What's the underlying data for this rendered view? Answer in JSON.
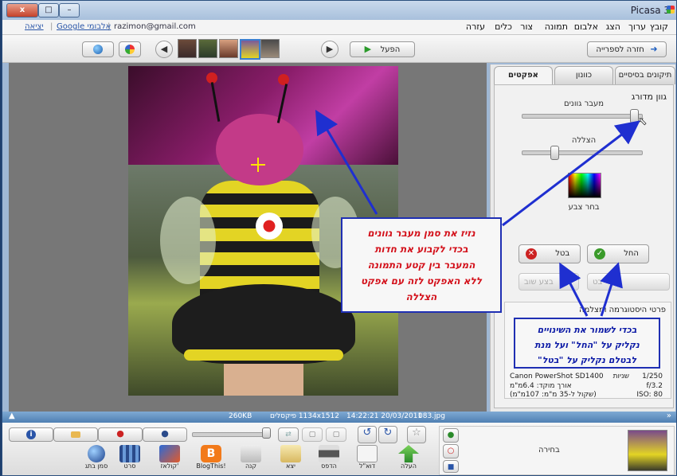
{
  "window": {
    "title": "Picasa 3",
    "close": "x",
    "max": "□",
    "min": "–"
  },
  "menu": [
    "קובץ",
    "ערוך",
    "הצג",
    "אלבום",
    "תמונה",
    "צור",
    "כלים",
    "עזרה"
  ],
  "account": {
    "email": "razimon@gmail.com",
    "google_link": "Google אלבומי",
    "exit": "יציאה"
  },
  "toolbar": {
    "back_label": "חזרה לספרייה",
    "play_label": "הפעל"
  },
  "tabs": [
    "תיקונים בסיסיים",
    "כוונון",
    "אפקטים"
  ],
  "effect": {
    "title": "גוון מדורג",
    "fade_label": "מעבר גוונים",
    "fade_level": 0.97,
    "shade_label": "הצללה",
    "shade_level": 0.25,
    "pick_color": "בחר צבע",
    "apply": "החל",
    "cancel": "בטל",
    "redo": "בצע שוב",
    "undo": "בט"
  },
  "exif": {
    "section_title": "פרטי היסטוגרמה ומצלמה",
    "camera": "Canon PowerShot SD1400",
    "focal": "אורך מוקד: 6.4מ\"מ",
    "equiv": "(שקול ל-35 מ\"מ: 107מ\"מ)",
    "shutter": "1/250",
    "shutter_unit": "שניות",
    "aperture": "f/3.2",
    "iso": "ISO: 80"
  },
  "callouts": {
    "main": [
      "נזיז את סמן מעבר גוונים",
      "בכדי לקבוע את חדות",
      "המעבר בין קטע התמונה",
      "ללא האפקט לזה עם אפקט",
      "הצללה"
    ],
    "save": [
      "בכדי לשמור את השינויים",
      "נקליק על \"החל\" ועל מנת",
      "לבטלם נקליק על \"בטל\""
    ]
  },
  "status": {
    "filename": "083.jpg",
    "datetime": "14:22:21 20/03/2011",
    "dimensions": "1134x1512 פיקסלים",
    "size": "260KB"
  },
  "bottom": {
    "selection_label": "בחירה",
    "actions": [
      "העלה",
      "דוא\"ל",
      "הדפס",
      "יצא",
      "קנה",
      "BlogThis!",
      "קולאז'",
      "סרט",
      "סמן בתג"
    ]
  },
  "colors": {
    "callout_border": "#1f2fb3",
    "callout_red": "#d3101a",
    "callout_blue": "#0c1aa6",
    "arrow": "#1f2fd0"
  }
}
